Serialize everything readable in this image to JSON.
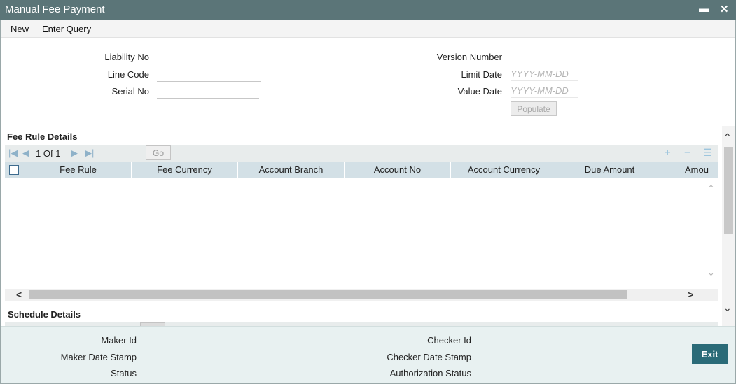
{
  "window": {
    "title": "Manual Fee Payment",
    "minimize_icon": "minimize-icon",
    "close_icon": "close-icon"
  },
  "menu": {
    "new": "New",
    "enter_query": "Enter Query"
  },
  "form": {
    "liability_no": {
      "label": "Liability No",
      "value": ""
    },
    "line_code": {
      "label": "Line Code",
      "value": ""
    },
    "serial_no": {
      "label": "Serial No",
      "value": ""
    },
    "version_number": {
      "label": "Version Number",
      "value": ""
    },
    "limit_date": {
      "label": "Limit Date",
      "placeholder": "YYYY-MM-DD"
    },
    "value_date": {
      "label": "Value Date",
      "placeholder": "YYYY-MM-DD"
    },
    "populate_label": "Populate"
  },
  "fee_rule_details": {
    "title": "Fee Rule Details",
    "pagination": {
      "current": "1",
      "of_label": "Of",
      "total": "1",
      "go_label": "Go"
    },
    "columns": [
      "Fee Rule",
      "Fee Currency",
      "Account Branch",
      "Account No",
      "Account Currency",
      "Due Amount",
      "Amou"
    ],
    "rows": []
  },
  "schedule_details": {
    "title": "Schedule Details"
  },
  "footer": {
    "maker_id": "Maker Id",
    "maker_date_stamp": "Maker Date Stamp",
    "status": "Status",
    "checker_id": "Checker Id",
    "checker_date_stamp": "Checker Date Stamp",
    "authorization_status": "Authorization Status",
    "exit_label": "Exit"
  },
  "colors": {
    "titlebar": "#5b7578",
    "grid_header": "#d3e0e6",
    "footer": "#e8f1f1",
    "exit_button": "#2a6b78"
  }
}
